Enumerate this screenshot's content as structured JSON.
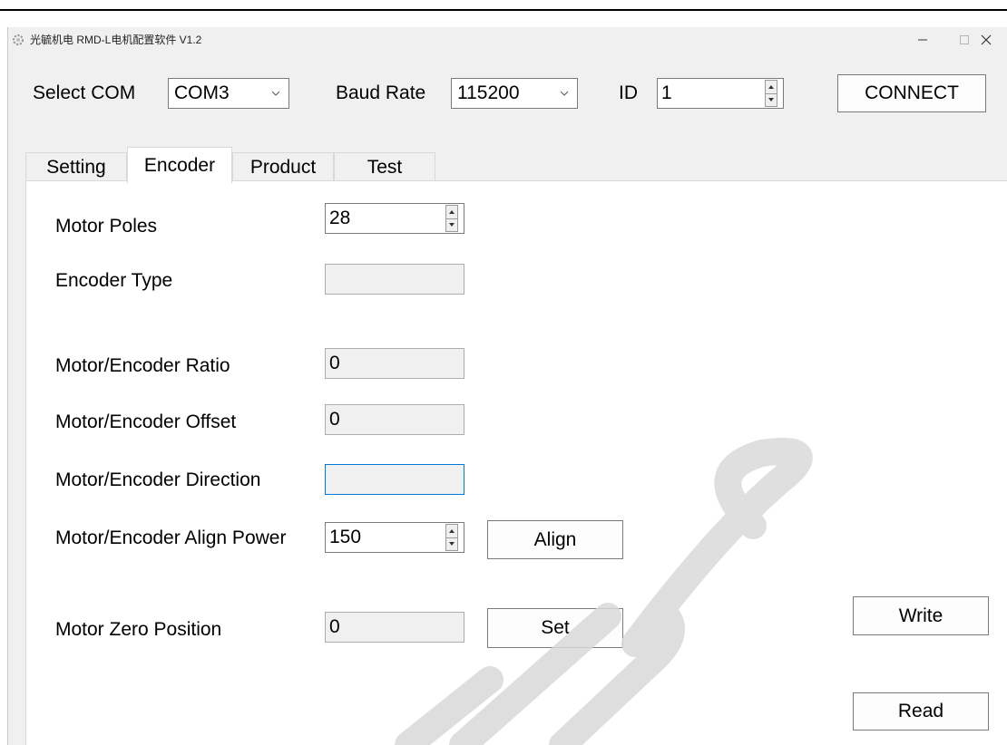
{
  "window": {
    "title": "光毓机电 RMD-L电机配置软件 V1.2",
    "controls": {
      "minimize": "minimize-icon",
      "maximize": "maximize-icon",
      "close": "close-icon"
    }
  },
  "toolbar": {
    "com_label": "Select COM",
    "com_value": "COM3",
    "baud_label": "Baud Rate",
    "baud_value": "115200",
    "id_label": "ID",
    "id_value": "1",
    "connect_label": "CONNECT"
  },
  "tabs": [
    {
      "label": "Setting",
      "active": false
    },
    {
      "label": "Encoder",
      "active": true
    },
    {
      "label": "Product",
      "active": false
    },
    {
      "label": "Test",
      "active": false
    }
  ],
  "encoder": {
    "motor_poles": {
      "label": "Motor Poles",
      "value": "28"
    },
    "encoder_type": {
      "label": "Encoder Type",
      "value": ""
    },
    "ratio": {
      "label": "Motor/Encoder Ratio",
      "value": "0"
    },
    "offset": {
      "label": "Motor/Encoder Offset",
      "value": "0"
    },
    "direction": {
      "label": "Motor/Encoder Direction",
      "value": ""
    },
    "align_power": {
      "label": "Motor/Encoder Align Power",
      "value": "150",
      "button": "Align"
    },
    "zero_position": {
      "label": "Motor Zero Position",
      "value": "0",
      "button": "Set"
    },
    "write_label": "Write",
    "read_label": "Read"
  },
  "colors": {
    "focus_border": "#0078d7",
    "window_bg": "#f0f0f0",
    "panel_bg": "#ffffff"
  }
}
